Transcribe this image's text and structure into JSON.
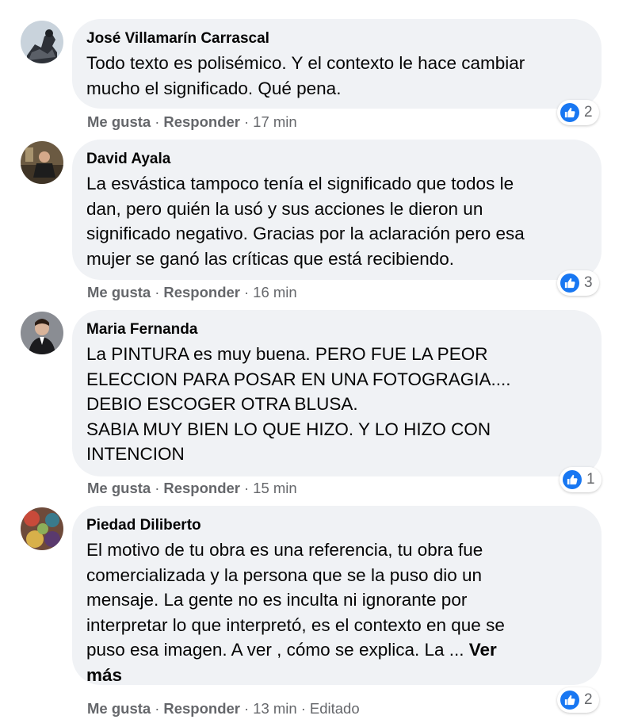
{
  "comments": [
    {
      "author": "José Villamarín Carrascal",
      "text": "Todo texto es polisémico. Y el contexto le hace cambiar\nmucho el significado. Qué pena.",
      "like_label": "Me gusta",
      "reply_label": "Responder",
      "time": "17 min",
      "reactions": "2"
    },
    {
      "author": "David Ayala",
      "text": "La esvástica tampoco tenía el significado que todos le\ndan, pero quién la usó y sus acciones le dieron un\nsignificado negativo. Gracias por la aclaración pero esa\nmujer se ganó las críticas que está recibiendo.",
      "like_label": "Me gusta",
      "reply_label": "Responder",
      "time": "16 min",
      "reactions": "3"
    },
    {
      "author": "Maria Fernanda",
      "text": "La PINTURA es muy buena. PERO FUE LA PEOR\nELECCION PARA POSAR EN UNA FOTOGRAGIA....\nDEBIO ESCOGER OTRA BLUSA.\nSABIA MUY BIEN LO QUE HIZO. Y LO HIZO CON\nINTENCION",
      "like_label": "Me gusta",
      "reply_label": "Responder",
      "time": "15 min",
      "reactions": "1"
    },
    {
      "author": "Piedad Diliberto",
      "text": "El motivo de tu obra es una referencia, tu obra fue\ncomercializada y la persona que se la puso dio un\nmensaje. La gente no es inculta ni ignorante por\ninterpretar lo que interpretó, es el contexto en que se\npuso esa imagen. A ver , cómo se explica. La ... ",
      "see_more": "Ver\nmás",
      "like_label": "Me gusta",
      "reply_label": "Responder",
      "time": "13 min",
      "edited": "Editado",
      "reactions": "2"
    }
  ],
  "colors": {
    "bubble": "#f0f2f5",
    "meta_text": "#65676b",
    "like_blue": "#1877f2"
  },
  "icons": {
    "reaction": "thumbs-up-icon"
  }
}
